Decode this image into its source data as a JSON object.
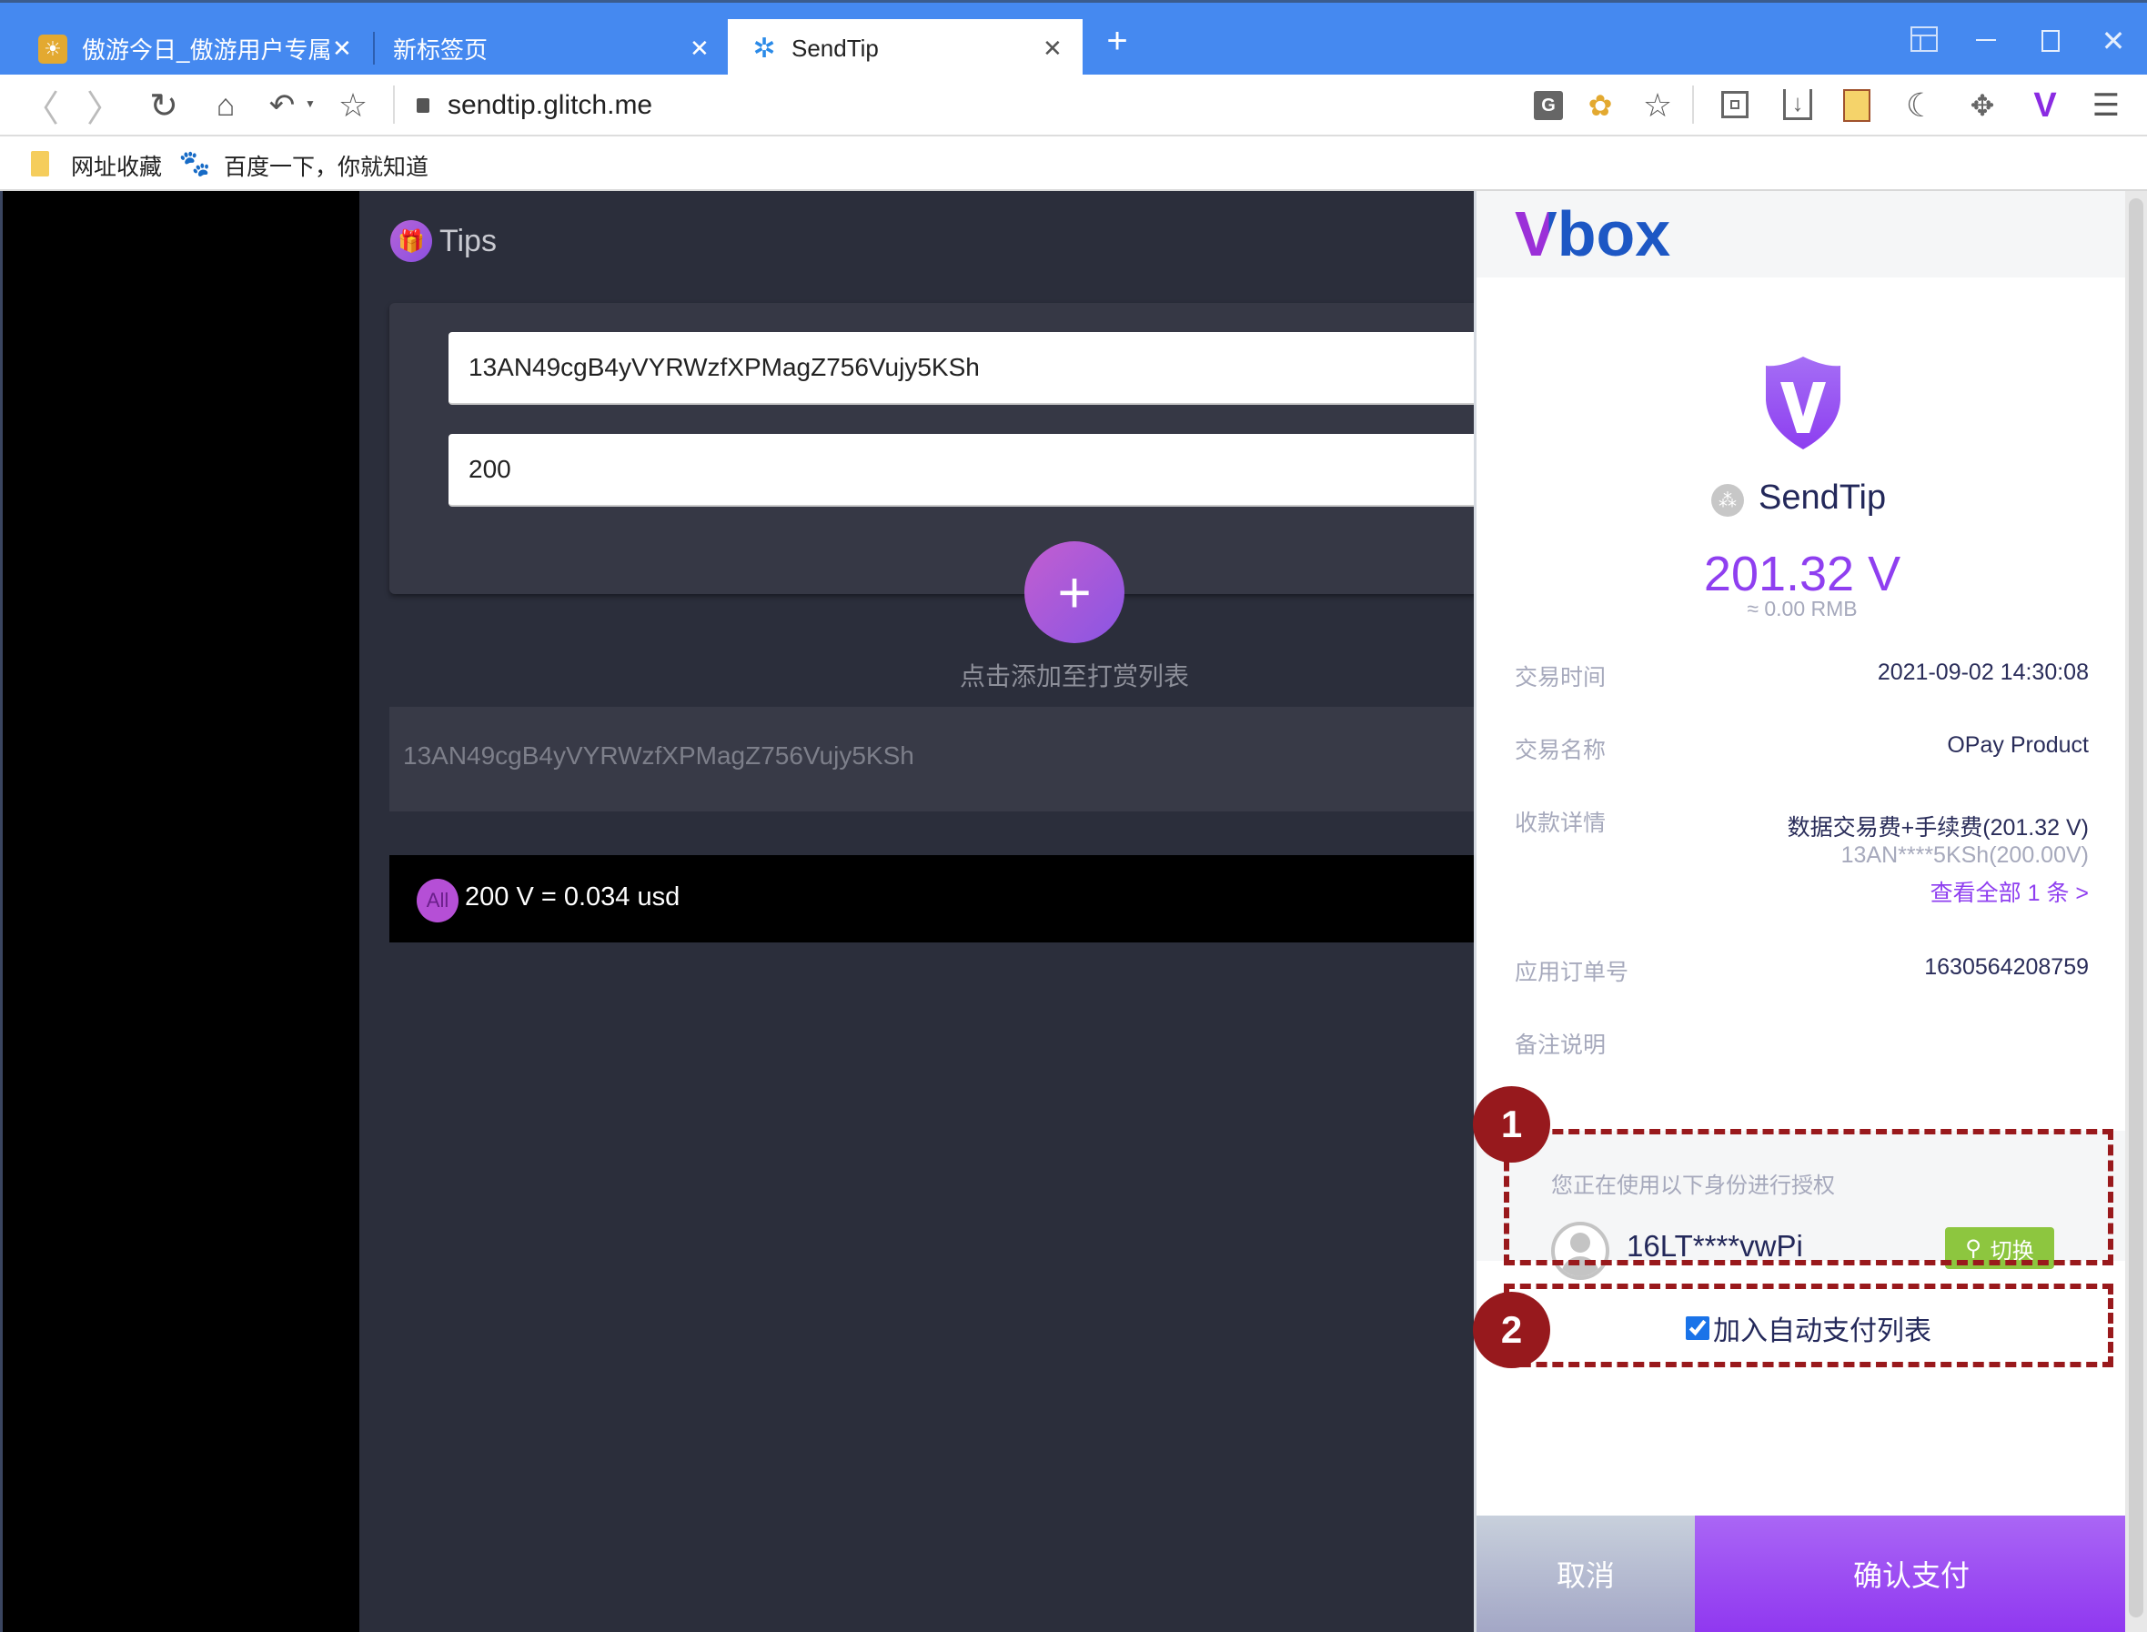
{
  "browser": {
    "tabs": [
      {
        "title": "傲游今日_傲游用户专属"
      },
      {
        "title": "新标签页"
      },
      {
        "title": "SendTip",
        "active": true
      }
    ],
    "url": "sendtip.glitch.me",
    "bookmarks": [
      {
        "label": "网址收藏"
      },
      {
        "label": "百度一下，你就知道"
      }
    ]
  },
  "page": {
    "title": "Tips",
    "address_value": "13AN49cgB4yVYRWzfXPMagZ756Vujy5KSh",
    "amount_value": "200",
    "add_hint": "点击添加至打赏列表",
    "list": [
      {
        "address": "13AN49cgB4yVYRWzfXPMagZ756Vujy5KSh"
      }
    ],
    "total_badge": "All",
    "total_text": "200 V = 0.034 usd"
  },
  "vbox": {
    "logo": "Vbox",
    "app_name": "SendTip",
    "amount": "201.32 V",
    "amount_rmb": "≈ 0.00 RMB",
    "rows": [
      {
        "label": "交易时间",
        "value": "2021-09-02 14:30:08"
      },
      {
        "label": "交易名称",
        "value": "OPay Product"
      },
      {
        "label": "收款详情",
        "value": "数据交易费+手续费(201.32 V)",
        "sub": "13AN****5KSh(200.00V)",
        "link": "查看全部 1 条 >"
      },
      {
        "label": "应用订单号",
        "value": "1630564208759"
      },
      {
        "label": "备注说明",
        "value": ""
      }
    ],
    "auth_title": "您正在使用以下身份进行授权",
    "account": "16LT****vwPi",
    "switch_label": "切换",
    "auto_pay_label": "加入自动支付列表",
    "auto_pay_checked": true,
    "cancel_label": "取消",
    "confirm_label": "确认支付",
    "accent": "#8f3ff0"
  },
  "annotations": [
    "1",
    "2"
  ]
}
